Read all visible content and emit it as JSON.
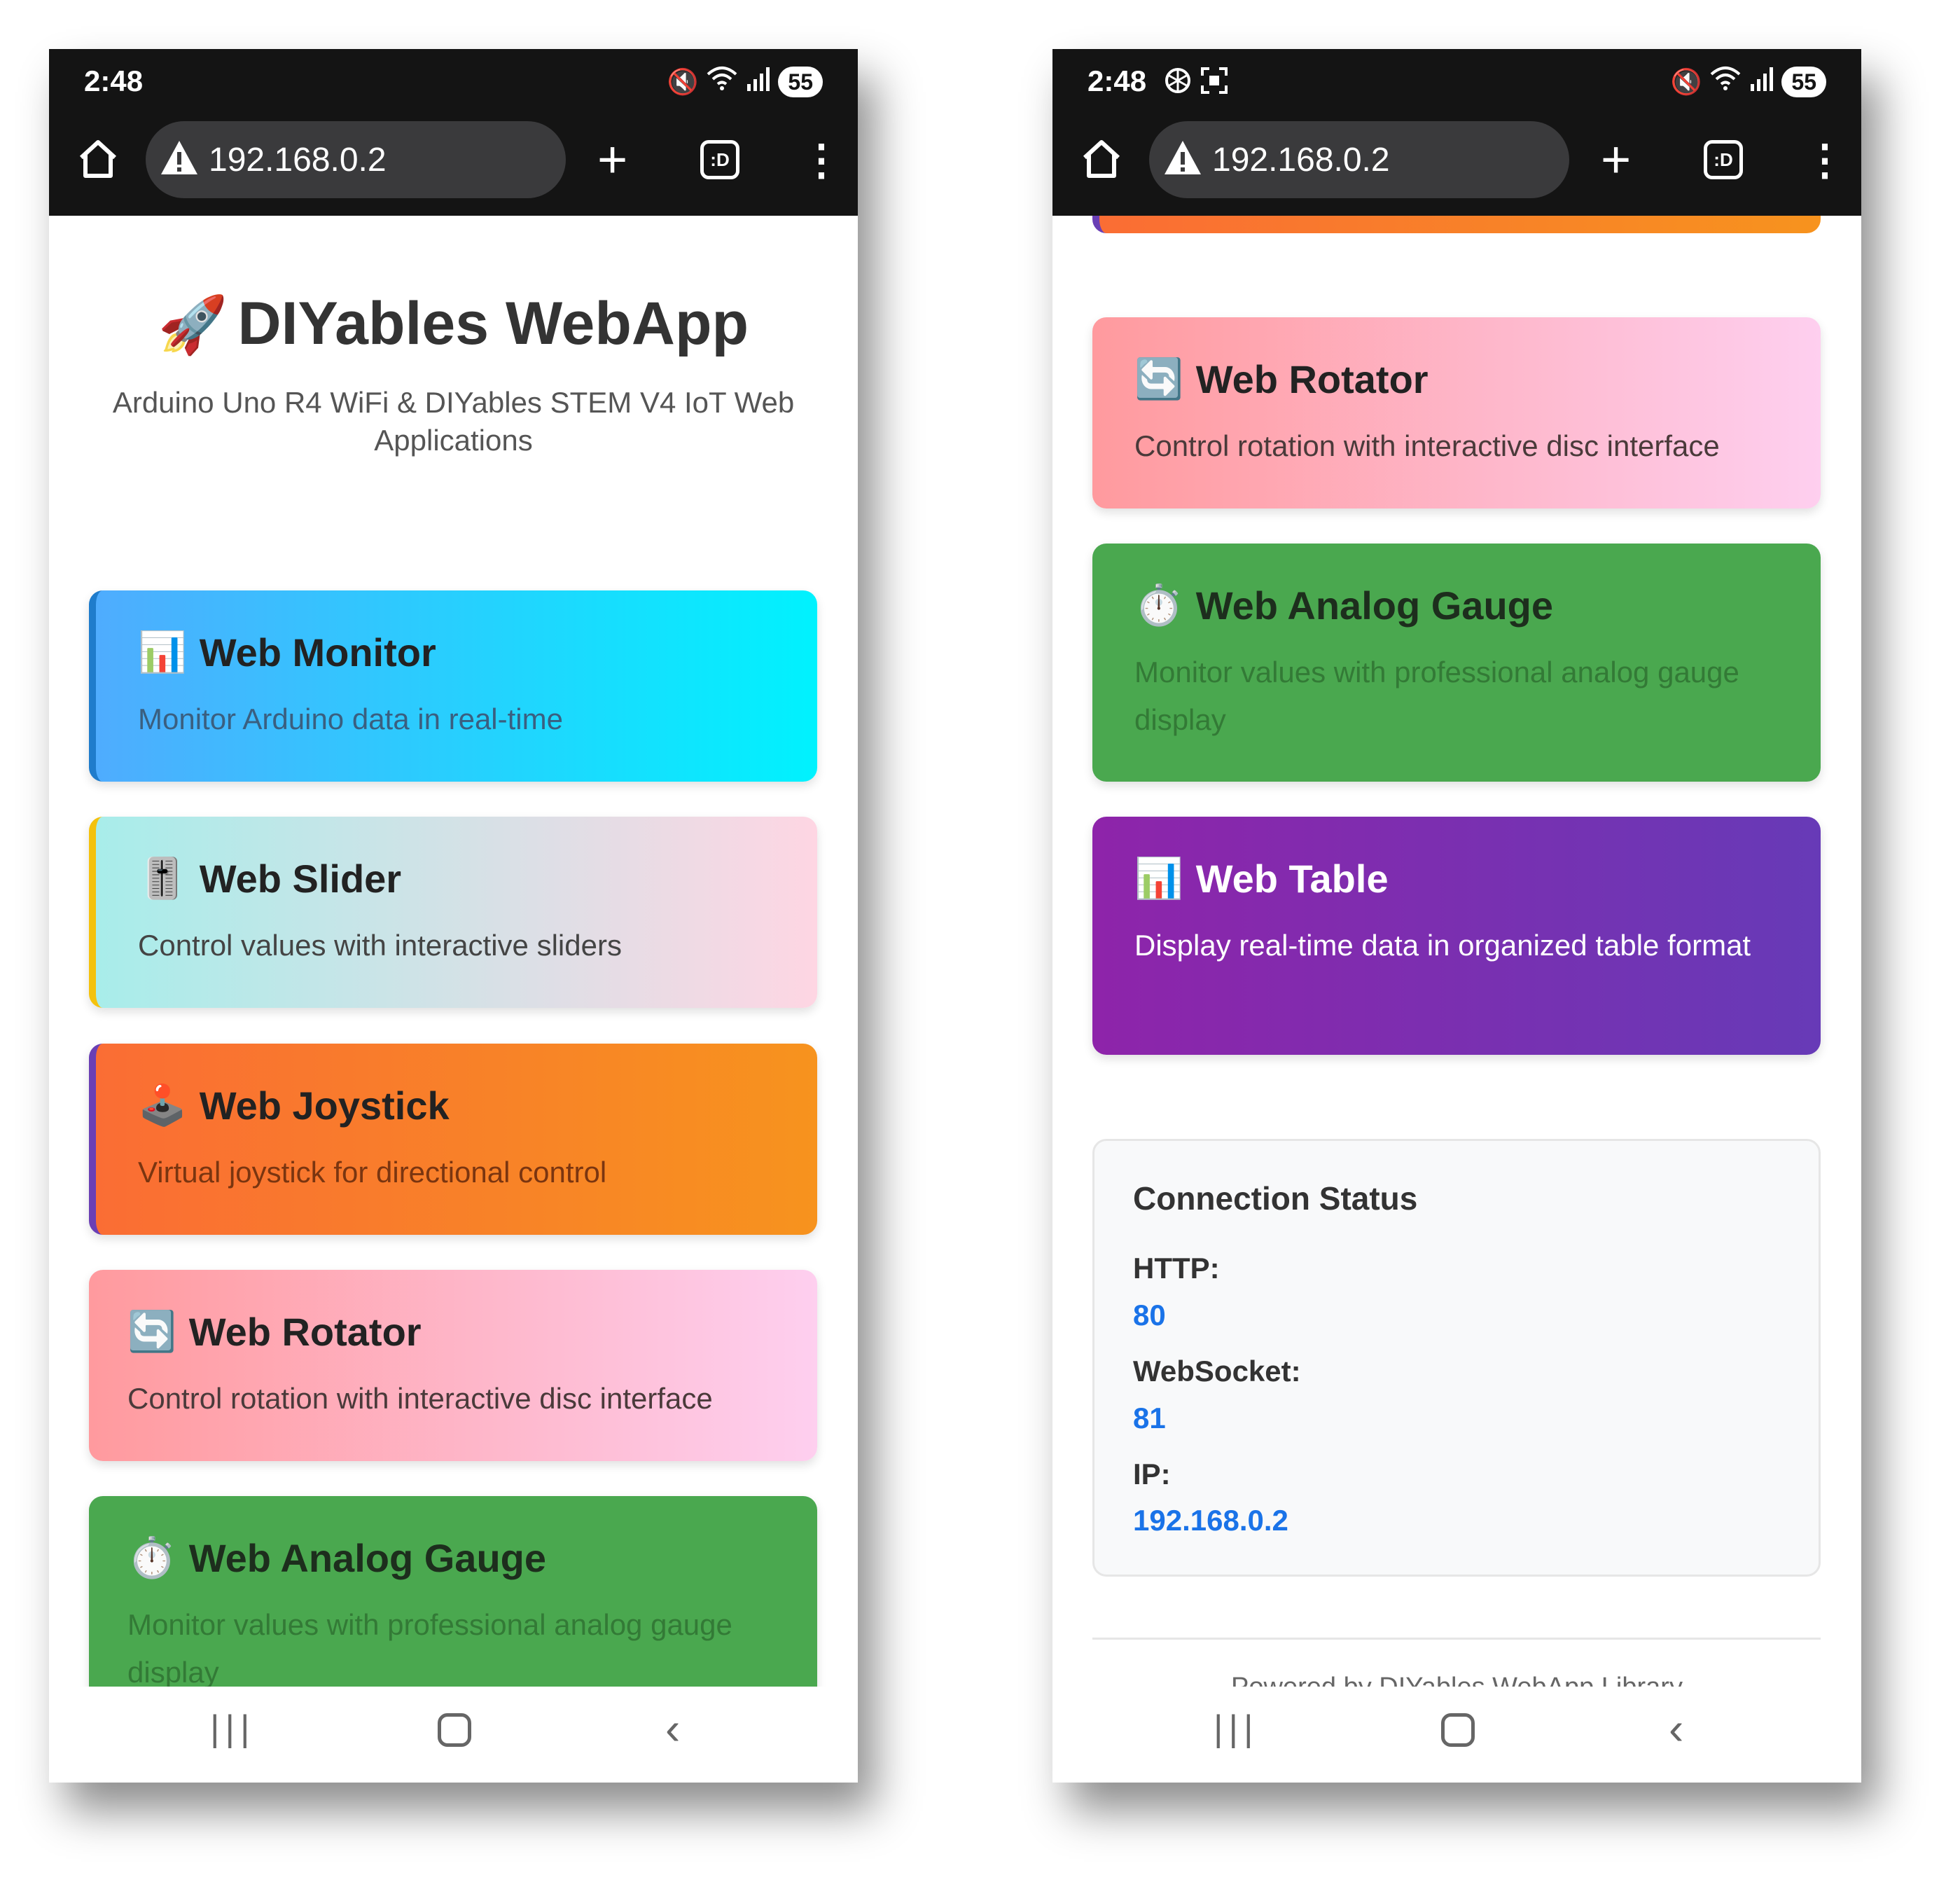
{
  "status_bar": {
    "time": "2:48",
    "battery": "55"
  },
  "browser": {
    "url": "192.168.0.2"
  },
  "header": {
    "title": "DIYables WebApp",
    "subtitle": "Arduino Uno R4 WiFi & DIYables STEM V4 IoT Web Applications"
  },
  "cards": {
    "monitor": {
      "title": "Web Monitor",
      "desc": "Monitor Arduino data in real-time",
      "icon": "bar-chart-icon"
    },
    "slider": {
      "title": "Web Slider",
      "desc": "Control values with interactive sliders",
      "icon": "slider-icon"
    },
    "joystick": {
      "title": "Web Joystick",
      "desc": "Virtual joystick for directional control",
      "icon": "joystick-icon"
    },
    "rotator": {
      "title": "Web Rotator",
      "desc": "Control rotation with interactive disc interface",
      "icon": "rotate-icon"
    },
    "gauge": {
      "title": "Web Analog Gauge",
      "desc": "Monitor values with professional analog gauge display",
      "icon": "stopwatch-icon"
    },
    "table": {
      "title": "Web Table",
      "desc": "Display real-time data in organized table format",
      "icon": "bar-chart-icon"
    }
  },
  "connection": {
    "title": "Connection Status",
    "http_label": "HTTP:",
    "http_value": "80",
    "websocket_label": "WebSocket:",
    "websocket_value": "81",
    "ip_label": "IP:",
    "ip_value": "192.168.0.2"
  },
  "footer": {
    "text": "Powered by DIYables WebApp Library"
  },
  "colors": {
    "status_bar": "#141414",
    "link_blue": "#1a73e8",
    "gauge_green": "#4aa84f",
    "table_purple": "#8e24aa"
  }
}
